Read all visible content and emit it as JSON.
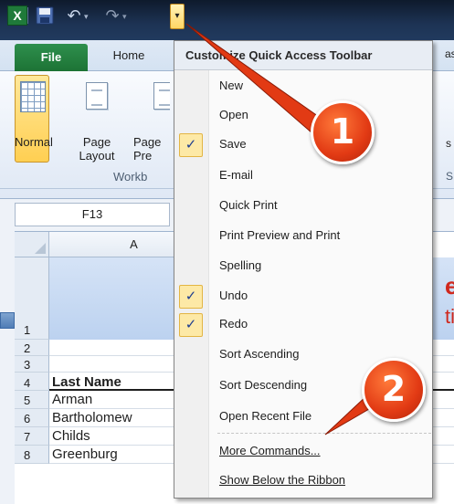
{
  "qat": {
    "app_icon": "X",
    "icons": [
      "excel-logo-icon",
      "save-icon",
      "undo-icon",
      "redo-icon",
      "customize-qat-icon"
    ]
  },
  "ribbon": {
    "tabs": {
      "file": "File",
      "home": "Home",
      "cut_right": "as"
    },
    "buttons": {
      "normal": "Normal",
      "page_layout": "Page Layout",
      "page_preview": "Page Pre"
    },
    "group_label": "Workb",
    "right_cut_1": "s",
    "right_cut_2": "S"
  },
  "name_box": {
    "value": "F13"
  },
  "sheet": {
    "column_header": "A",
    "rows": [
      {
        "num": "1",
        "value": ""
      },
      {
        "num": "2",
        "value": ""
      },
      {
        "num": "3",
        "value": ""
      },
      {
        "num": "4",
        "value": "Last Name"
      },
      {
        "num": "5",
        "value": "Arman"
      },
      {
        "num": "6",
        "value": "Bartholomew"
      },
      {
        "num": "7",
        "value": "Childs"
      },
      {
        "num": "8",
        "value": "Greenburg"
      }
    ],
    "cut_red_1": "e",
    "cut_red_2": "ti"
  },
  "menu": {
    "title": "Customize Quick Access Toolbar",
    "items": [
      {
        "label": "New",
        "checked": false
      },
      {
        "label": "Open",
        "checked": false
      },
      {
        "label": "Save",
        "checked": true
      },
      {
        "label": "E-mail",
        "checked": false
      },
      {
        "label": "Quick Print",
        "checked": false
      },
      {
        "label": "Print Preview and Print",
        "checked": false
      },
      {
        "label": "Spelling",
        "checked": false
      },
      {
        "label": "Undo",
        "checked": true
      },
      {
        "label": "Redo",
        "checked": true
      },
      {
        "label": "Sort Ascending",
        "checked": false
      },
      {
        "label": "Sort Descending",
        "checked": false
      },
      {
        "label": "Open Recent File",
        "checked": false
      }
    ],
    "more_commands": "More Commands...",
    "show_below": "Show Below the Ribbon",
    "checkmark": "✓"
  },
  "callouts": {
    "badge_1": "1",
    "badge_2": "2"
  }
}
